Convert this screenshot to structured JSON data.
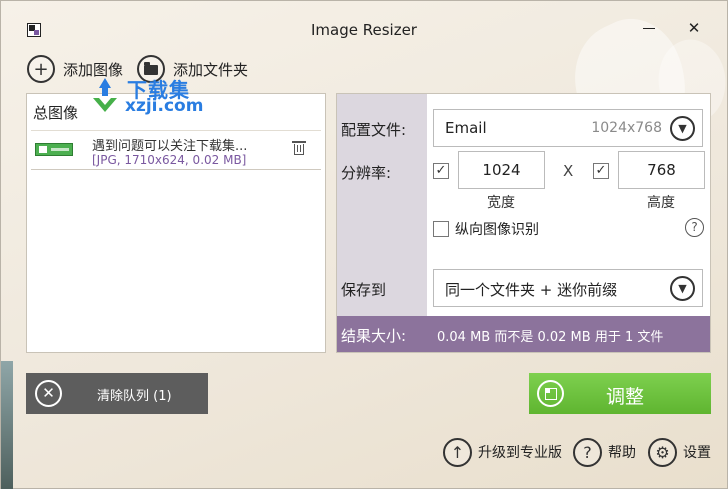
{
  "window": {
    "title": "Image Resizer",
    "minimize_glyph": "",
    "close_glyph": "✕"
  },
  "toolbar": {
    "add_image_label": "添加图像",
    "add_folder_label": "添加文件夹"
  },
  "queue": {
    "header": "总图像",
    "watermark_line1": "下载集",
    "watermark_line2": "xzji.com",
    "items": [
      {
        "name": "遇到问题可以关注下载集...",
        "meta": "[JPG, 1710x624, 0.02 MB]"
      }
    ]
  },
  "settings": {
    "profile_label": "配置文件:",
    "profile_value": "Email",
    "profile_size": "1024x768",
    "resolution_label": "分辨率:",
    "width_value": "1024",
    "height_value": "768",
    "x_separator": "X",
    "width_label": "宽度",
    "height_label": "高度",
    "portrait_label": "纵向图像识别",
    "save_to_label": "保存到",
    "save_to_value": "同一个文件夹 + 迷你前缀",
    "result_label": "结果大小:",
    "result_text": "0.04 MB 而不是 0.02 MB 用于 1 文件",
    "width_checked": true,
    "height_checked": true,
    "portrait_checked": false
  },
  "actions": {
    "clear_queue_label": "清除队列 (1)",
    "resize_label": "调整",
    "upgrade_label": "升级到专业版",
    "help_label": "帮助",
    "settings_label": "设置"
  },
  "colors": {
    "accent_purple": "#8c739c",
    "resize_green": "#6cc23e",
    "clear_gray": "#5d5d5d",
    "watermark_blue": "#2a7de1"
  }
}
